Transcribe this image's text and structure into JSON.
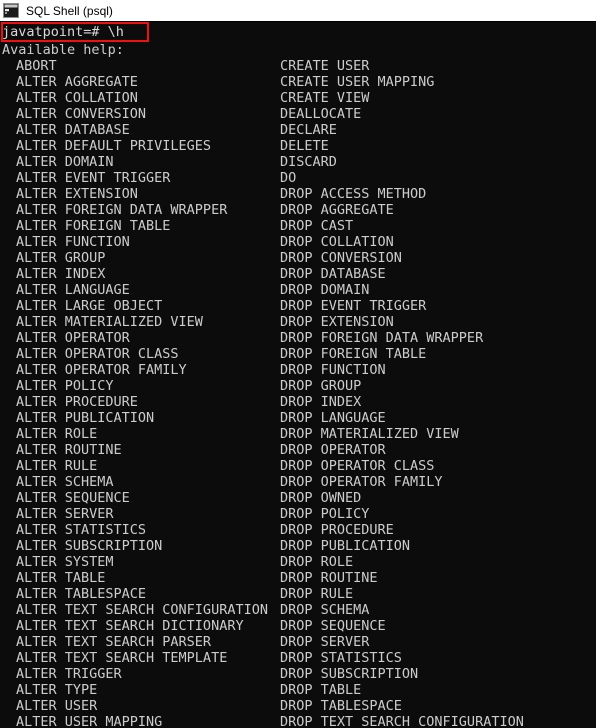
{
  "window": {
    "title": "SQL Shell (psql)",
    "icon": "console-window-icon",
    "background_color": "#0c0c0c",
    "text_color": "#cccccc",
    "titlebar_color": "#ffffff"
  },
  "terminal": {
    "prompt_line": "javatpoint=# \\h",
    "prompt_highlight_color": "#ee1111",
    "heading": "Available help:",
    "left_column": [
      "ABORT",
      "ALTER AGGREGATE",
      "ALTER COLLATION",
      "ALTER CONVERSION",
      "ALTER DATABASE",
      "ALTER DEFAULT PRIVILEGES",
      "ALTER DOMAIN",
      "ALTER EVENT TRIGGER",
      "ALTER EXTENSION",
      "ALTER FOREIGN DATA WRAPPER",
      "ALTER FOREIGN TABLE",
      "ALTER FUNCTION",
      "ALTER GROUP",
      "ALTER INDEX",
      "ALTER LANGUAGE",
      "ALTER LARGE OBJECT",
      "ALTER MATERIALIZED VIEW",
      "ALTER OPERATOR",
      "ALTER OPERATOR CLASS",
      "ALTER OPERATOR FAMILY",
      "ALTER POLICY",
      "ALTER PROCEDURE",
      "ALTER PUBLICATION",
      "ALTER ROLE",
      "ALTER ROUTINE",
      "ALTER RULE",
      "ALTER SCHEMA",
      "ALTER SEQUENCE",
      "ALTER SERVER",
      "ALTER STATISTICS",
      "ALTER SUBSCRIPTION",
      "ALTER SYSTEM",
      "ALTER TABLE",
      "ALTER TABLESPACE",
      "ALTER TEXT SEARCH CONFIGURATION",
      "ALTER TEXT SEARCH DICTIONARY",
      "ALTER TEXT SEARCH PARSER",
      "ALTER TEXT SEARCH TEMPLATE",
      "ALTER TRIGGER",
      "ALTER TYPE",
      "ALTER USER",
      "ALTER USER MAPPING"
    ],
    "right_column": [
      "CREATE USER",
      "CREATE USER MAPPING",
      "CREATE VIEW",
      "DEALLOCATE",
      "DECLARE",
      "DELETE",
      "DISCARD",
      "DO",
      "DROP ACCESS METHOD",
      "DROP AGGREGATE",
      "DROP CAST",
      "DROP COLLATION",
      "DROP CONVERSION",
      "DROP DATABASE",
      "DROP DOMAIN",
      "DROP EVENT TRIGGER",
      "DROP EXTENSION",
      "DROP FOREIGN DATA WRAPPER",
      "DROP FOREIGN TABLE",
      "DROP FUNCTION",
      "DROP GROUP",
      "DROP INDEX",
      "DROP LANGUAGE",
      "DROP MATERIALIZED VIEW",
      "DROP OPERATOR",
      "DROP OPERATOR CLASS",
      "DROP OPERATOR FAMILY",
      "DROP OWNED",
      "DROP POLICY",
      "DROP PROCEDURE",
      "DROP PUBLICATION",
      "DROP ROLE",
      "DROP ROUTINE",
      "DROP RULE",
      "DROP SCHEMA",
      "DROP SEQUENCE",
      "DROP SERVER",
      "DROP STATISTICS",
      "DROP SUBSCRIPTION",
      "DROP TABLE",
      "DROP TABLESPACE",
      "DROP TEXT SEARCH CONFIGURATION"
    ]
  }
}
